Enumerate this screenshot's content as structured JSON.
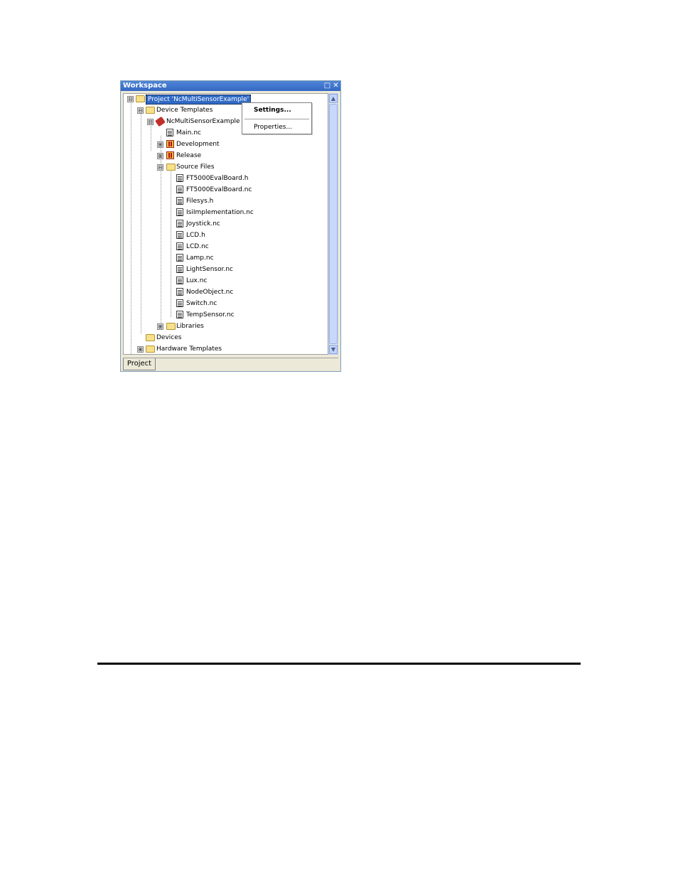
{
  "window": {
    "title": "Workspace",
    "restore_glyph": "□",
    "close_glyph": "✕"
  },
  "tree": {
    "items": [
      {
        "label": "Project 'NcMultiSensorExample'",
        "expander": "⊟",
        "icon": "folder-open-icon",
        "selected": true
      },
      {
        "label": "Device Templates",
        "expander": "⊟",
        "icon": "folder-open-icon"
      },
      {
        "label": "NcMultiSensorExample",
        "expander": "⊟",
        "icon": "device-template-icon"
      },
      {
        "label": "Main.nc",
        "icon": "file-icon"
      },
      {
        "label": "Development",
        "expander": "⊞",
        "icon": "build-config-icon"
      },
      {
        "label": "Release",
        "expander": "⊞",
        "icon": "build-config-icon"
      },
      {
        "label": "Source Files",
        "expander": "⊟",
        "icon": "folder-open-icon"
      },
      {
        "label": "FT5000EvalBoard.h",
        "icon": "file-icon"
      },
      {
        "label": "FT5000EvalBoard.nc",
        "icon": "file-icon"
      },
      {
        "label": "Filesys.h",
        "icon": "file-icon"
      },
      {
        "label": "IsiImplementation.nc",
        "icon": "file-icon"
      },
      {
        "label": "Joystick.nc",
        "icon": "file-icon"
      },
      {
        "label": "LCD.h",
        "icon": "file-icon"
      },
      {
        "label": "LCD.nc",
        "icon": "file-icon"
      },
      {
        "label": "Lamp.nc",
        "icon": "file-icon"
      },
      {
        "label": "LightSensor.nc",
        "icon": "file-icon"
      },
      {
        "label": "Lux.nc",
        "icon": "file-icon"
      },
      {
        "label": "NodeObject.nc",
        "icon": "file-icon"
      },
      {
        "label": "Switch.nc",
        "icon": "file-icon"
      },
      {
        "label": "TempSensor.nc",
        "icon": "file-icon"
      },
      {
        "label": "Libraries",
        "expander": "⊞",
        "icon": "folder-icon"
      },
      {
        "label": "Devices",
        "icon": "folder-icon"
      },
      {
        "label": "Hardware Templates",
        "expander": "⊞",
        "icon": "folder-icon"
      }
    ]
  },
  "context_menu": {
    "settings_label": "Settings...",
    "properties_label": "Properties..."
  },
  "tabs": {
    "project_label": "Project"
  },
  "scrollbar": {
    "up_glyph": "▲",
    "down_glyph": "▼"
  },
  "colors": {
    "titlebar": "#3d72cf",
    "selection": "#316ac5",
    "folder": "#f6e08a"
  }
}
